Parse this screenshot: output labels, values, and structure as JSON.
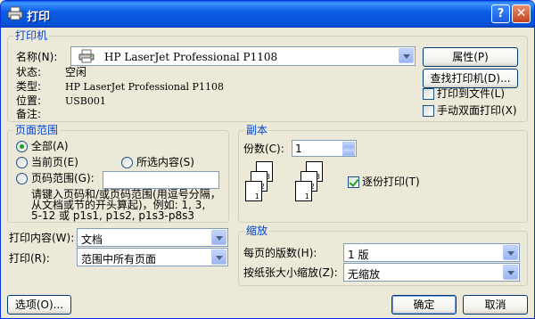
{
  "window": {
    "title": "打印",
    "help_label": "?",
    "close_label": "✕"
  },
  "printer": {
    "legend": "打印机",
    "name_label": "名称(N):",
    "name_value": "HP LaserJet Professional P1108",
    "status_label": "状态:",
    "status_value": "空闲",
    "type_label": "类型:",
    "type_value": "HP LaserJet Professional P1108",
    "location_label": "位置:",
    "location_value": "USB001",
    "comment_label": "备注:",
    "comment_value": "",
    "properties_label": "属性(P)",
    "find_label": "查找打印机(D)...",
    "print_to_file_label": "打印到文件(L)",
    "print_to_file_checked": false,
    "manual_duplex_label": "手动双面打印(X)",
    "manual_duplex_checked": false
  },
  "page_range": {
    "legend": "页面范围",
    "all_label": "全部(A)",
    "current_label": "当前页(E)",
    "selection_label": "所选内容(S)",
    "pages_label": "页码范围(G):",
    "pages_value": "",
    "selected": "all",
    "hint_line1": "请键入页码和/或页码范围(用逗号分隔，",
    "hint_line2": "从文档或节的开头算起)，例如: 1, 3,",
    "hint_line3": "5-12 或 p1s1, p1s2, p1s3-p8s3"
  },
  "print_what": {
    "label": "打印内容(W):",
    "value": "文档"
  },
  "print_which": {
    "label": "打印(R):",
    "value": "范围中所有页面"
  },
  "copies": {
    "legend": "副本",
    "count_label": "份数(C):",
    "count_value": "1",
    "collate_label": "逐份打印(T)",
    "collate_checked": true,
    "page_numbers": [
      "1",
      "2",
      "3"
    ]
  },
  "zoom": {
    "legend": "缩放",
    "pages_per_sheet_label": "每页的版数(H):",
    "pages_per_sheet_value": "1 版",
    "scale_label": "按纸张大小缩放(Z):",
    "scale_value": "无缩放"
  },
  "footer": {
    "options_label": "选项(O)...",
    "ok_label": "确定",
    "cancel_label": "取消"
  }
}
